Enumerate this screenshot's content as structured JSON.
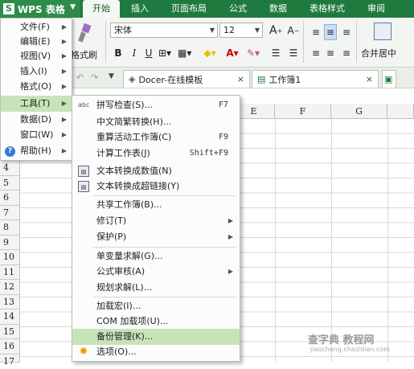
{
  "app": {
    "name": "WPS 表格",
    "logo": "S"
  },
  "ribbon_tabs": [
    "开始",
    "插入",
    "页面布局",
    "公式",
    "数据",
    "表格样式",
    "审阅"
  ],
  "ribbon": {
    "format_painter": "格式刷",
    "font_name": "宋体",
    "font_size": "12",
    "bold": "B",
    "italic": "I",
    "underline": "U",
    "merge_center": "合并居中"
  },
  "doc_tabs": [
    {
      "label": "Docer-在线模板",
      "close": "×"
    },
    {
      "label": "工作簿1",
      "close": "×"
    }
  ],
  "columns": [
    "E",
    "F",
    "G"
  ],
  "rows": [
    "4",
    "5",
    "6",
    "7",
    "8",
    "9",
    "10",
    "11",
    "12",
    "13",
    "14",
    "15",
    "16",
    "17",
    "18"
  ],
  "main_menu": [
    {
      "label": "文件(F)"
    },
    {
      "label": "编辑(E)"
    },
    {
      "label": "视图(V)"
    },
    {
      "label": "插入(I)"
    },
    {
      "label": "格式(O)"
    },
    {
      "label": "工具(T)"
    },
    {
      "label": "数据(D)"
    },
    {
      "label": "窗口(W)"
    },
    {
      "label": "帮助(H)"
    }
  ],
  "tools_menu": [
    {
      "label": "拼写检查(S)...",
      "shortcut": "F7"
    },
    {
      "label": "中文简繁转换(H)...",
      "shortcut": ""
    },
    {
      "label": "重算活动工作簿(C)",
      "shortcut": "F9"
    },
    {
      "label": "计算工作表(J)",
      "shortcut": "Shift+F9"
    },
    {
      "label": "文本转换成数值(N)",
      "shortcut": ""
    },
    {
      "label": "文本转换成超链接(Y)",
      "shortcut": ""
    },
    {
      "label": "共享工作簿(B)...",
      "shortcut": ""
    },
    {
      "label": "修订(T)",
      "shortcut": ""
    },
    {
      "label": "保护(P)",
      "shortcut": ""
    },
    {
      "label": "单变量求解(G)...",
      "shortcut": ""
    },
    {
      "label": "公式审核(A)",
      "shortcut": ""
    },
    {
      "label": "规划求解(L)...",
      "shortcut": ""
    },
    {
      "label": "加载宏(I)...",
      "shortcut": ""
    },
    {
      "label": "COM 加载项(U)...",
      "shortcut": ""
    },
    {
      "label": "备份管理(K)...",
      "shortcut": ""
    },
    {
      "label": "选项(O)...",
      "shortcut": ""
    }
  ],
  "spell_icon_text": "abc",
  "watermark": {
    "line1": "查字典 教程网",
    "line2": "jiaocheng.chazidian.com"
  },
  "colors": {
    "brand_green": "#1f7a3f",
    "highlight": "#c7e4b8"
  }
}
